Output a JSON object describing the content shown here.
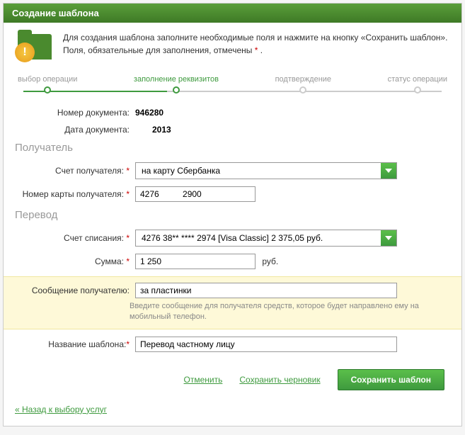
{
  "title": "Создание шаблона",
  "intro": {
    "line1": "Для создания шаблона заполните необходимые поля и нажмите на кнопку «Сохранить шаблон».",
    "line2_a": "Поля, обязательные для заполнения, отмечены ",
    "line2_b": " ."
  },
  "steps": [
    "выбор операции",
    "заполнение реквизитов",
    "подтверждение",
    "статус операции"
  ],
  "labels": {
    "docnum": "Номер документа:",
    "docdate": "Дата документа:",
    "section_recipient": "Получатель",
    "recipient_account": "Счет получателя:",
    "recipient_card": "Номер карты получателя:",
    "section_transfer": "Перевод",
    "writeoff_account": "Счет списания:",
    "amount": "Сумма:",
    "message": "Сообщение получателю:",
    "template_name": "Название шаблона:",
    "currency": "руб."
  },
  "values": {
    "docnum": "946280",
    "docdate": "2013",
    "recipient_account": "на карту Сбербанка",
    "recipient_card": "4276          2900",
    "writeoff_account": "4276 38** **** 2974  [Visa Classic] 2 375,05  руб.",
    "amount": "1 250",
    "message": "за пластинки",
    "template_name": "Перевод частному лицу"
  },
  "hint": "Введите сообщение для получателя средств, которое будет направлено ему на мобильный телефон.",
  "actions": {
    "cancel": "Отменить",
    "draft": "Сохранить черновик",
    "save": "Сохранить шаблон"
  },
  "back": "« Назад к выбору услуг"
}
